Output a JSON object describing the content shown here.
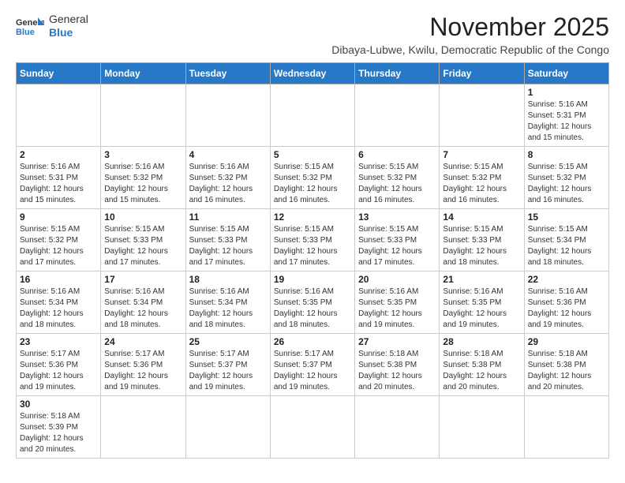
{
  "logo": {
    "text_general": "General",
    "text_blue": "Blue"
  },
  "header": {
    "month": "November 2025",
    "location": "Dibaya-Lubwe, Kwilu, Democratic Republic of the Congo"
  },
  "weekdays": [
    "Sunday",
    "Monday",
    "Tuesday",
    "Wednesday",
    "Thursday",
    "Friday",
    "Saturday"
  ],
  "weeks": [
    [
      {
        "day": "",
        "info": ""
      },
      {
        "day": "",
        "info": ""
      },
      {
        "day": "",
        "info": ""
      },
      {
        "day": "",
        "info": ""
      },
      {
        "day": "",
        "info": ""
      },
      {
        "day": "",
        "info": ""
      },
      {
        "day": "1",
        "info": "Sunrise: 5:16 AM\nSunset: 5:31 PM\nDaylight: 12 hours and 15 minutes."
      }
    ],
    [
      {
        "day": "2",
        "info": "Sunrise: 5:16 AM\nSunset: 5:31 PM\nDaylight: 12 hours and 15 minutes."
      },
      {
        "day": "3",
        "info": "Sunrise: 5:16 AM\nSunset: 5:32 PM\nDaylight: 12 hours and 15 minutes."
      },
      {
        "day": "4",
        "info": "Sunrise: 5:16 AM\nSunset: 5:32 PM\nDaylight: 12 hours and 16 minutes."
      },
      {
        "day": "5",
        "info": "Sunrise: 5:15 AM\nSunset: 5:32 PM\nDaylight: 12 hours and 16 minutes."
      },
      {
        "day": "6",
        "info": "Sunrise: 5:15 AM\nSunset: 5:32 PM\nDaylight: 12 hours and 16 minutes."
      },
      {
        "day": "7",
        "info": "Sunrise: 5:15 AM\nSunset: 5:32 PM\nDaylight: 12 hours and 16 minutes."
      },
      {
        "day": "8",
        "info": "Sunrise: 5:15 AM\nSunset: 5:32 PM\nDaylight: 12 hours and 16 minutes."
      }
    ],
    [
      {
        "day": "9",
        "info": "Sunrise: 5:15 AM\nSunset: 5:32 PM\nDaylight: 12 hours and 17 minutes."
      },
      {
        "day": "10",
        "info": "Sunrise: 5:15 AM\nSunset: 5:33 PM\nDaylight: 12 hours and 17 minutes."
      },
      {
        "day": "11",
        "info": "Sunrise: 5:15 AM\nSunset: 5:33 PM\nDaylight: 12 hours and 17 minutes."
      },
      {
        "day": "12",
        "info": "Sunrise: 5:15 AM\nSunset: 5:33 PM\nDaylight: 12 hours and 17 minutes."
      },
      {
        "day": "13",
        "info": "Sunrise: 5:15 AM\nSunset: 5:33 PM\nDaylight: 12 hours and 17 minutes."
      },
      {
        "day": "14",
        "info": "Sunrise: 5:15 AM\nSunset: 5:33 PM\nDaylight: 12 hours and 18 minutes."
      },
      {
        "day": "15",
        "info": "Sunrise: 5:15 AM\nSunset: 5:34 PM\nDaylight: 12 hours and 18 minutes."
      }
    ],
    [
      {
        "day": "16",
        "info": "Sunrise: 5:16 AM\nSunset: 5:34 PM\nDaylight: 12 hours and 18 minutes."
      },
      {
        "day": "17",
        "info": "Sunrise: 5:16 AM\nSunset: 5:34 PM\nDaylight: 12 hours and 18 minutes."
      },
      {
        "day": "18",
        "info": "Sunrise: 5:16 AM\nSunset: 5:34 PM\nDaylight: 12 hours and 18 minutes."
      },
      {
        "day": "19",
        "info": "Sunrise: 5:16 AM\nSunset: 5:35 PM\nDaylight: 12 hours and 18 minutes."
      },
      {
        "day": "20",
        "info": "Sunrise: 5:16 AM\nSunset: 5:35 PM\nDaylight: 12 hours and 19 minutes."
      },
      {
        "day": "21",
        "info": "Sunrise: 5:16 AM\nSunset: 5:35 PM\nDaylight: 12 hours and 19 minutes."
      },
      {
        "day": "22",
        "info": "Sunrise: 5:16 AM\nSunset: 5:36 PM\nDaylight: 12 hours and 19 minutes."
      }
    ],
    [
      {
        "day": "23",
        "info": "Sunrise: 5:17 AM\nSunset: 5:36 PM\nDaylight: 12 hours and 19 minutes."
      },
      {
        "day": "24",
        "info": "Sunrise: 5:17 AM\nSunset: 5:36 PM\nDaylight: 12 hours and 19 minutes."
      },
      {
        "day": "25",
        "info": "Sunrise: 5:17 AM\nSunset: 5:37 PM\nDaylight: 12 hours and 19 minutes."
      },
      {
        "day": "26",
        "info": "Sunrise: 5:17 AM\nSunset: 5:37 PM\nDaylight: 12 hours and 19 minutes."
      },
      {
        "day": "27",
        "info": "Sunrise: 5:18 AM\nSunset: 5:38 PM\nDaylight: 12 hours and 20 minutes."
      },
      {
        "day": "28",
        "info": "Sunrise: 5:18 AM\nSunset: 5:38 PM\nDaylight: 12 hours and 20 minutes."
      },
      {
        "day": "29",
        "info": "Sunrise: 5:18 AM\nSunset: 5:38 PM\nDaylight: 12 hours and 20 minutes."
      }
    ],
    [
      {
        "day": "30",
        "info": "Sunrise: 5:18 AM\nSunset: 5:39 PM\nDaylight: 12 hours and 20 minutes."
      },
      {
        "day": "",
        "info": ""
      },
      {
        "day": "",
        "info": ""
      },
      {
        "day": "",
        "info": ""
      },
      {
        "day": "",
        "info": ""
      },
      {
        "day": "",
        "info": ""
      },
      {
        "day": "",
        "info": ""
      }
    ]
  ]
}
